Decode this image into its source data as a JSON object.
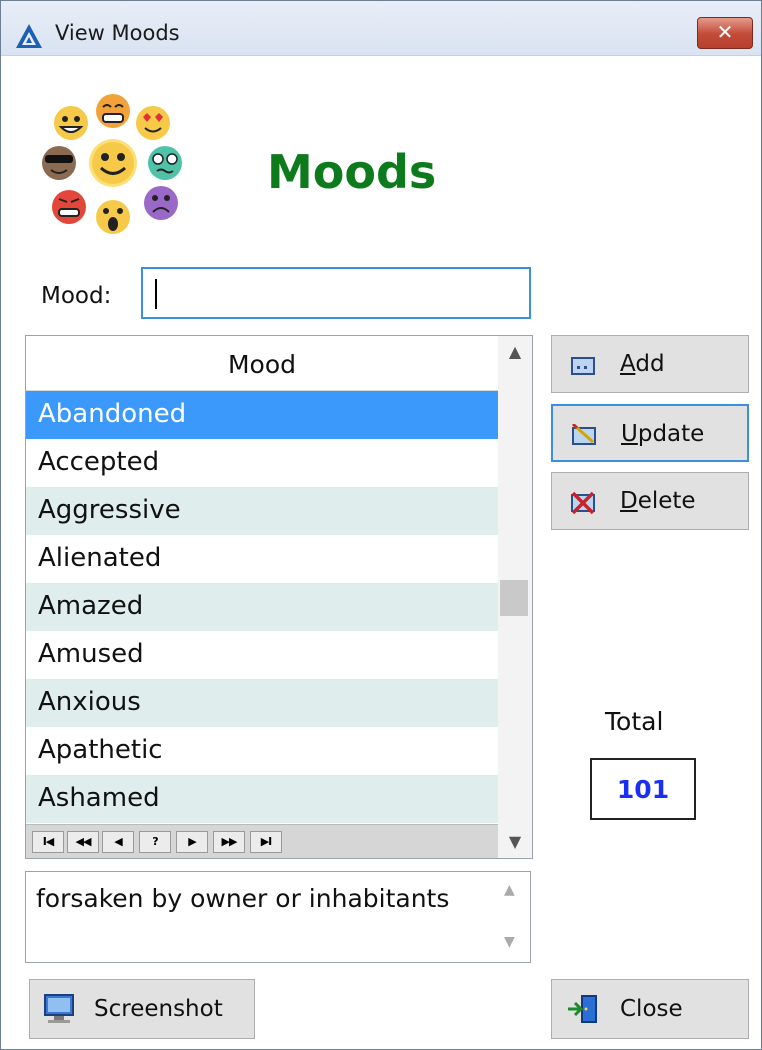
{
  "window": {
    "title": "View Moods",
    "close_glyph": "✕",
    "app_icon": "app-triangle-icon"
  },
  "header": {
    "title": "Moods",
    "logo": "emoji-cluster-logo"
  },
  "mood_field": {
    "label": "Mood:",
    "value": ""
  },
  "grid": {
    "column_header": "Mood",
    "rows": [
      "Abandoned",
      "Accepted",
      "Aggressive",
      "Alienated",
      "Amazed",
      "Amused",
      "Anxious",
      "Apathetic",
      "Ashamed"
    ],
    "selected_index": 0,
    "navigation": [
      "I◀",
      "◀◀",
      "◀",
      "?",
      "▶",
      "▶▶",
      "▶I"
    ]
  },
  "buttons": {
    "add": {
      "mnemonic": "A",
      "rest": "dd"
    },
    "update": {
      "mnemonic": "U",
      "rest": "pdate"
    },
    "delete": {
      "mnemonic": "D",
      "rest": "elete"
    },
    "screenshot": "Screenshot",
    "close": "Close"
  },
  "total": {
    "label": "Total",
    "value": "101"
  },
  "description": "forsaken by owner or inhabitants",
  "colors": {
    "heading": "#0d7a1b",
    "selection": "#3b99fc",
    "alt_row": "#e0eded",
    "total_value": "#1a2ff5",
    "focus_border": "#3b8fe0"
  }
}
